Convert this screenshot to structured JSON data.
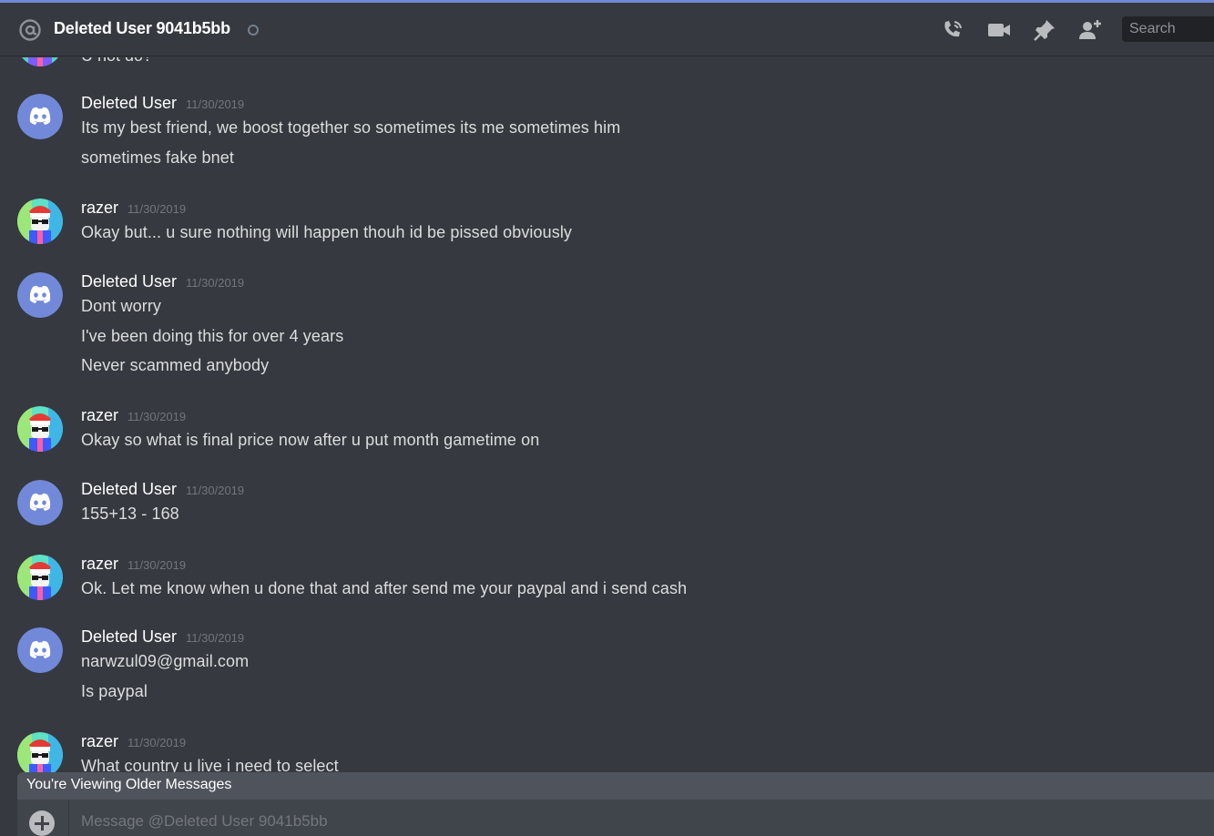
{
  "header": {
    "title": "Deleted User 9041b5bb",
    "search_placeholder": "Search"
  },
  "partial_top_text": "U not do?",
  "messages": [
    {
      "author": "Deleted User",
      "timestamp": "11/30/2019",
      "avatar": "discord-logo-icon",
      "lines": [
        "Its my best friend, we boost together so sometimes its me sometimes him",
        "sometimes fake bnet"
      ]
    },
    {
      "author": "razer",
      "timestamp": "11/30/2019",
      "avatar": "razer-avatar",
      "lines": [
        "Okay but... u sure nothing will happen thouh id be pissed obviously"
      ]
    },
    {
      "author": "Deleted User",
      "timestamp": "11/30/2019",
      "avatar": "discord-logo-icon",
      "lines": [
        "Dont worry",
        "I've been doing this for over 4 years",
        "Never scammed anybody"
      ]
    },
    {
      "author": "razer",
      "timestamp": "11/30/2019",
      "avatar": "razer-avatar",
      "lines": [
        "Okay so what is final price now after u put month gametime on"
      ]
    },
    {
      "author": "Deleted User",
      "timestamp": "11/30/2019",
      "avatar": "discord-logo-icon",
      "lines": [
        "155+13 - 168"
      ]
    },
    {
      "author": "razer",
      "timestamp": "11/30/2019",
      "avatar": "razer-avatar",
      "lines": [
        "Ok. Let me know when u done that and after send me your paypal and i send cash"
      ]
    },
    {
      "author": "Deleted User",
      "timestamp": "11/30/2019",
      "avatar": "discord-logo-icon",
      "lines": [
        "narwzul09@gmail.com",
        "Is paypal"
      ]
    },
    {
      "author": "razer",
      "timestamp": "11/30/2019",
      "avatar": "razer-avatar",
      "lines": [
        "What country u live i need to select"
      ]
    }
  ],
  "older_messages_bar": "You're Viewing Older Messages",
  "composer": {
    "placeholder": "Message @Deleted User 9041b5bb"
  },
  "colors": {
    "background": "#36393f",
    "blurple": "#7289da",
    "timestamp": "#72767d"
  }
}
